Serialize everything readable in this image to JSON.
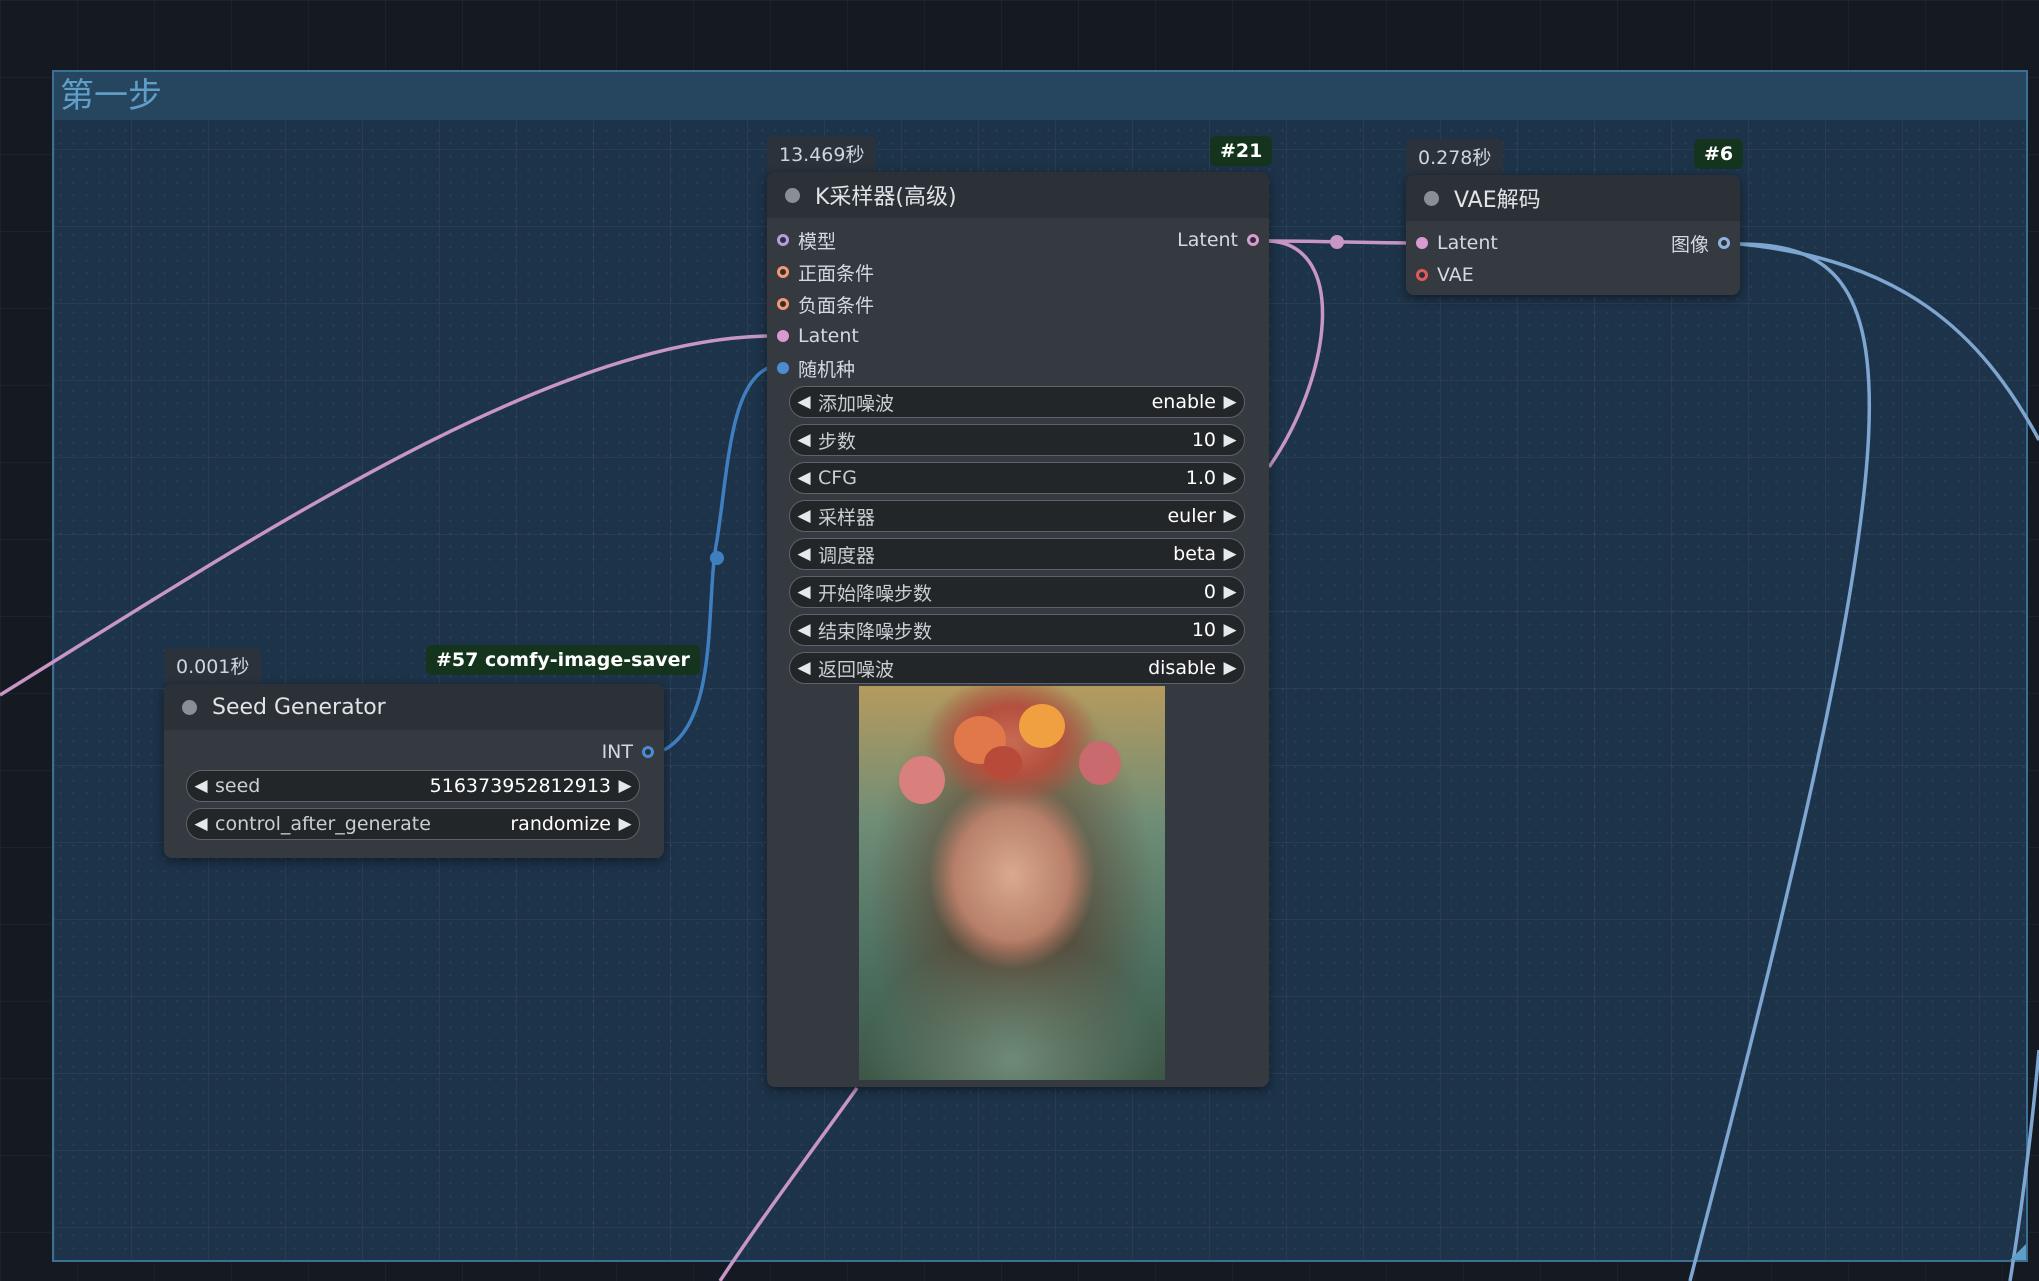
{
  "group": {
    "title": "第一步"
  },
  "ksampler": {
    "time": "13.469秒",
    "id": "#21",
    "title": "K采样器(高级)",
    "inputs": [
      {
        "label": "模型",
        "color": "#b39ddb",
        "ring": true
      },
      {
        "label": "正面条件",
        "color": "#f29a6e",
        "ring": true
      },
      {
        "label": "负面条件",
        "color": "#f29a6e",
        "ring": true
      },
      {
        "label": "Latent",
        "color": "#d99ad0",
        "ring": false
      },
      {
        "label": "随机种",
        "color": "#4a8ed0",
        "ring": false
      }
    ],
    "output": {
      "label": "Latent",
      "color": "#d99ad0"
    },
    "widgets": [
      {
        "label": "添加噪波",
        "value": "enable"
      },
      {
        "label": "步数",
        "value": "10"
      },
      {
        "label": "CFG",
        "value": "1.0"
      },
      {
        "label": "采样器",
        "value": "euler"
      },
      {
        "label": "调度器",
        "value": "beta"
      },
      {
        "label": "开始降噪步数",
        "value": "0"
      },
      {
        "label": "结束降噪步数",
        "value": "10"
      },
      {
        "label": "返回噪波",
        "value": "disable"
      }
    ]
  },
  "vae": {
    "time": "0.278秒",
    "id": "#6",
    "title": "VAE解码",
    "inputs": [
      {
        "label": "Latent",
        "color": "#d99ad0",
        "ring": false
      },
      {
        "label": "VAE",
        "color": "#e05a5a",
        "ring": true
      }
    ],
    "output": {
      "label": "图像",
      "color": "#8fb3e0"
    }
  },
  "seed": {
    "time": "0.001秒",
    "id": "#57 comfy-image-saver",
    "title": "Seed Generator",
    "output": {
      "label": "INT",
      "color": "#4a8ed0"
    },
    "widgets": [
      {
        "label": "seed",
        "value": "516373952812913"
      },
      {
        "label": "control_after_generate",
        "value": "randomize"
      }
    ]
  },
  "colors": {
    "latent_wire": "#c896c4",
    "int_wire": "#3f7fc0",
    "image_wire": "#7ea6d0"
  }
}
